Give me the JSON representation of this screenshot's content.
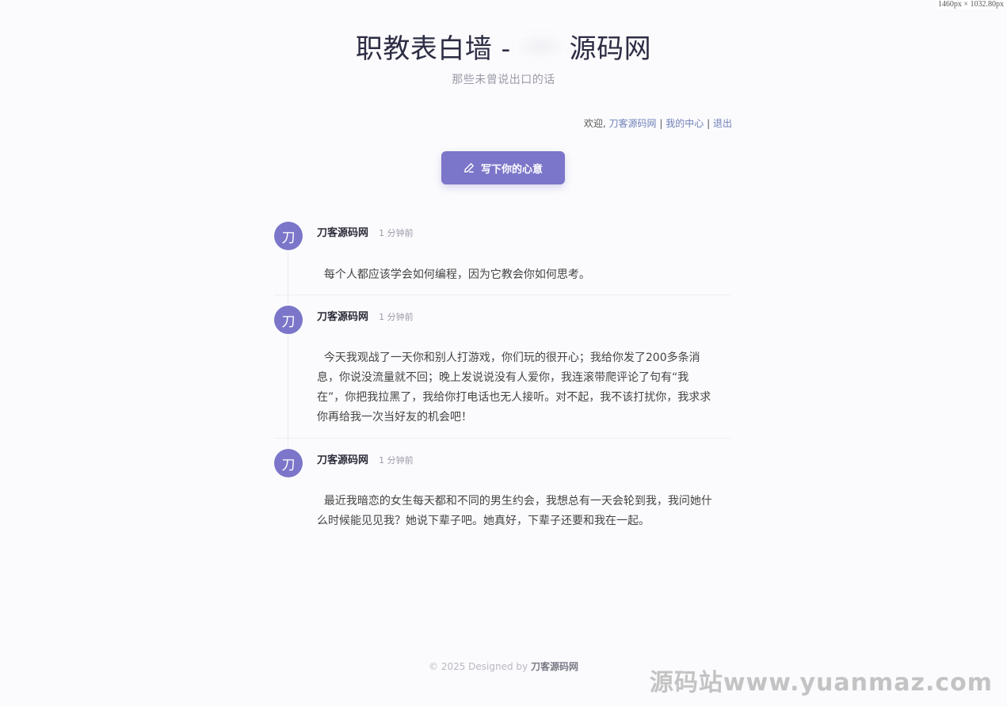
{
  "viewport_indicator": "1460px × 1032.80px",
  "header": {
    "title_left": "职教表白墙 -",
    "title_right": "源码网",
    "subtitle": "那些未曾说出口的话"
  },
  "user_bar": {
    "welcome": "欢迎,",
    "username": "刀客源码网",
    "separator": "|",
    "my_center": "我的中心",
    "logout": "退出"
  },
  "write_button": {
    "label": "写下你的心意",
    "icon": "pencil-icon"
  },
  "posts": [
    {
      "avatar": "刀",
      "author": "刀客源码网",
      "time": "1 分钟前",
      "content_lines": [
        "  每个人都应该学会如何编程，因为它教会你如何思考。"
      ]
    },
    {
      "avatar": "刀",
      "author": "刀客源码网",
      "time": "1 分钟前",
      "content_lines": [
        "  今天我观战了一天你和别人打游戏，你们玩的很开心；我给你发了200多条消",
        "息，你说没流量就不回；晚上发说说没有人爱你，我连滚带爬评论了句有“我",
        "在”，你把我拉黑了，我给你打电话也无人接听。对不起，我不该打扰你，我求求",
        "你再给我一次当好友的机会吧！"
      ]
    },
    {
      "avatar": "刀",
      "author": "刀客源码网",
      "time": "1 分钟前",
      "content_lines": [
        "  最近我暗恋的女生每天都和不同的男生约会，我想总有一天会轮到我，我问她什",
        "么时候能见见我？她说下辈子吧。她真好，下辈子还要和我在一起。"
      ]
    }
  ],
  "footer": {
    "text": "© 2025 Designed by",
    "author": "刀客源码网"
  },
  "watermark": "源码站www.yuanmaz.com",
  "colors": {
    "accent": "#7b76c9",
    "link": "#6f7fb8",
    "background": "#fbfbfd"
  }
}
